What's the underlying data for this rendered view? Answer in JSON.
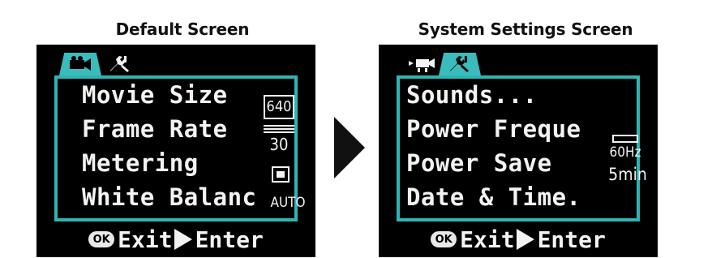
{
  "left": {
    "caption": "Default Screen",
    "menu": [
      {
        "label": "Movie Size",
        "value": "640"
      },
      {
        "label": "Frame Rate",
        "value": "30"
      },
      {
        "label": "Metering",
        "value": ""
      },
      {
        "label": "White Balanc",
        "value": "AUTO"
      }
    ],
    "footer": {
      "ok": "OK",
      "exit": "Exit",
      "enter": "Enter"
    },
    "active_tab": "movie-tab"
  },
  "right": {
    "caption": "System Settings Screen",
    "menu": [
      {
        "label": "Sounds...",
        "value": ""
      },
      {
        "label": "Power Freque",
        "value": "60Hz"
      },
      {
        "label": "Power Save",
        "value": "5min"
      },
      {
        "label": "Date & Time.",
        "value": ""
      }
    ],
    "footer": {
      "ok": "OK",
      "exit": "Exit",
      "enter": "Enter"
    },
    "active_tab": "settings-tab"
  },
  "colors": {
    "accent": "#2fb4b4",
    "screen_bg": "#000000",
    "text": "#f3f3f3"
  },
  "icons": {
    "movie": "movie-camera-icon",
    "settings": "wrench-tool-icon",
    "arrow": "right-arrow-icon"
  }
}
